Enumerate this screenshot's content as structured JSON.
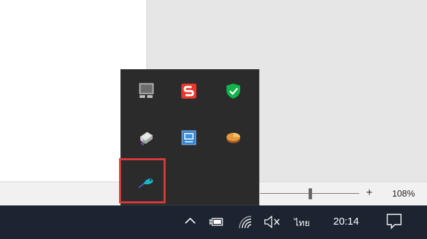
{
  "status_bar": {
    "zoom_plus": "+",
    "zoom_level": "108%"
  },
  "taskbar": {
    "language": "ไทย",
    "clock": "20:14"
  },
  "tray_icons": {
    "shown": [
      "chevron-up-icon",
      "battery-charging-icon",
      "wifi-icon",
      "volume-muted-icon",
      "notification-icon"
    ],
    "overflow": [
      "monitor-icon",
      "sejda-s-icon",
      "shield-check-icon",
      "printer-icon",
      "network-app-icon",
      "pie-icon",
      "hummingbird-icon"
    ]
  },
  "colors": {
    "taskbar": "#1c2431",
    "flyout": "#2b2b2b",
    "highlight": "#d9393a"
  }
}
